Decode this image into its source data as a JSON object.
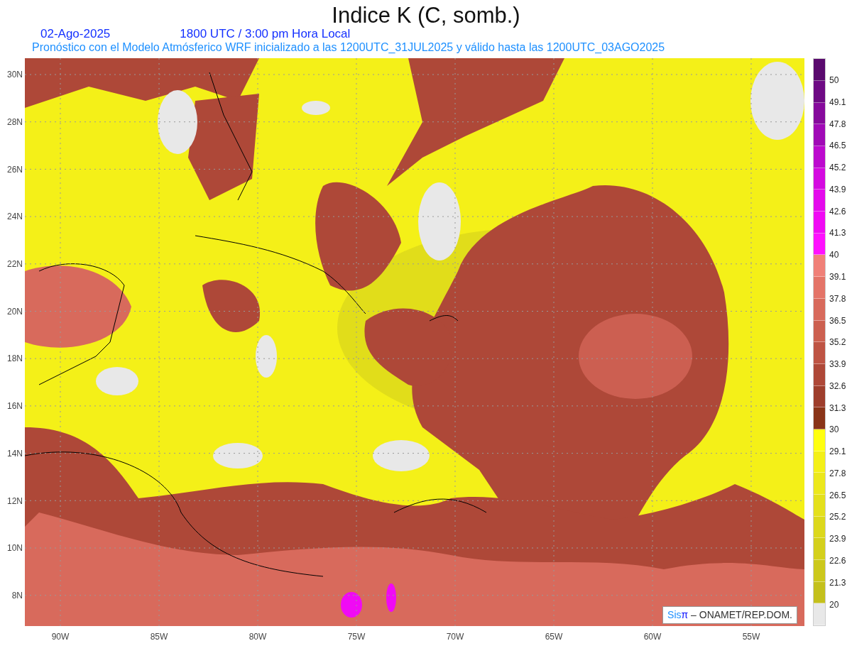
{
  "title": "Indice K (C, somb.)",
  "date": "02-Ago-2025",
  "time": "1800 UTC / 3:00 pm Hora Local",
  "subtitle": "Pronóstico con el Modelo Atmósferico WRF inicializado a las 1200UTC_31JUL2025 y válido hasta las  1200UTC_03AGO2025",
  "lat_labels": [
    "30N",
    "28N",
    "26N",
    "24N",
    "22N",
    "20N",
    "18N",
    "16N",
    "14N",
    "12N",
    "10N",
    "8N"
  ],
  "lon_labels": [
    "90W",
    "85W",
    "80W",
    "75W",
    "70W",
    "65W",
    "60W",
    "55W"
  ],
  "colorbar": [
    {
      "color": "#5a0a6e",
      "label": "50"
    },
    {
      "color": "#6e0a84",
      "label": "49.1"
    },
    {
      "color": "#860a9c",
      "label": "47.8"
    },
    {
      "color": "#a00ab6",
      "label": "46.5"
    },
    {
      "color": "#bc0ace",
      "label": "45.2"
    },
    {
      "color": "#d40ae0",
      "label": "43.9"
    },
    {
      "color": "#e40aec",
      "label": "42.6"
    },
    {
      "color": "#f00af4",
      "label": "41.3"
    },
    {
      "color": "#ff10ff",
      "label": "40"
    },
    {
      "color": "#f08078",
      "label": "39.1"
    },
    {
      "color": "#e47468",
      "label": "37.8"
    },
    {
      "color": "#d86a5c",
      "label": "36.5"
    },
    {
      "color": "#cc6050",
      "label": "35.2"
    },
    {
      "color": "#be5444",
      "label": "33.9"
    },
    {
      "color": "#ae4838",
      "label": "32.6"
    },
    {
      "color": "#9e3e2c",
      "label": "31.3"
    },
    {
      "color": "#8a3418",
      "label": "30"
    },
    {
      "color": "#ffff10",
      "label": "29.1"
    },
    {
      "color": "#f4f018",
      "label": "27.8"
    },
    {
      "color": "#ece81c",
      "label": "26.5"
    },
    {
      "color": "#e4e01c",
      "label": "25.2"
    },
    {
      "color": "#dcd81c",
      "label": "23.9"
    },
    {
      "color": "#d4d01c",
      "label": "22.6"
    },
    {
      "color": "#ccc81c",
      "label": "21.3"
    },
    {
      "color": "#c4c01c",
      "label": "20"
    },
    {
      "color": "#e8e8e8"
    }
  ],
  "credit": [
    {
      "text": "Sis",
      "color": "#1e90ff"
    },
    {
      "text": "π",
      "color": "#0a10ff"
    },
    {
      "text": " – ONAMET/REP.DOM.",
      "color": "#333333"
    }
  ]
}
